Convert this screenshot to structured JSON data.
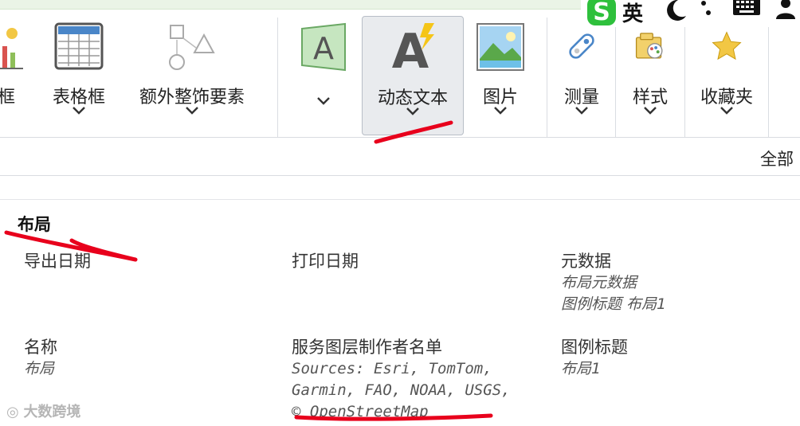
{
  "ribbon": {
    "frame_partial_label": "框",
    "table_frame_label": "表格框",
    "extra_elements_label": "额外整饰要素",
    "dynamic_text_label": "动态文本",
    "picture_label": "图片",
    "measure_label": "测量",
    "style_label": "样式",
    "favorites_label": "收藏夹"
  },
  "filter": {
    "label": "全部"
  },
  "section": {
    "title": "布局"
  },
  "items": {
    "export_date": {
      "title": "导出日期"
    },
    "print_date": {
      "title": "打印日期"
    },
    "metadata": {
      "title": "元数据",
      "line1": "布局元数据",
      "line2": "图例标题 布局1"
    },
    "name": {
      "title": "名称",
      "value": "布局"
    },
    "credits": {
      "title": "服务图层制作者名单",
      "line1": "Sources: Esri, TomTom,",
      "line2": "Garmin, FAO, NOAA, USGS,",
      "line3": "© OpenStreetMap"
    },
    "legend_title": {
      "title": "图例标题",
      "value": "布局1"
    }
  },
  "tray": {
    "ime_label": "英"
  },
  "watermark": {
    "text": "大数跨境"
  },
  "colors": {
    "accent": "#e8001c",
    "ribbon_active": "#e9ebee",
    "top_strip": "#eaf4e6"
  }
}
